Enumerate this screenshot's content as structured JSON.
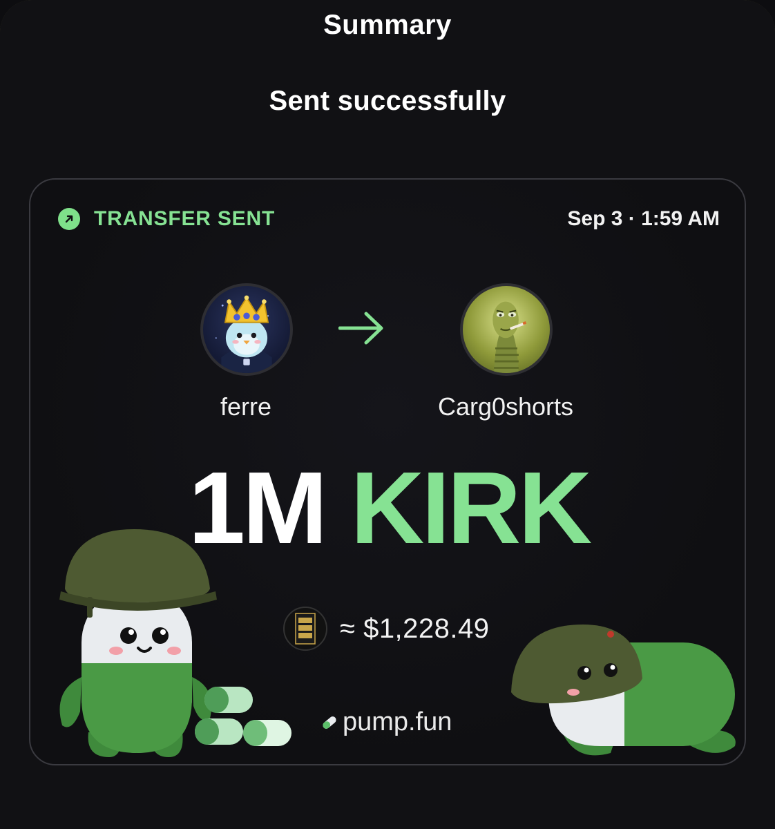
{
  "header": {
    "title": "Summary"
  },
  "status": {
    "subtitle": "Sent successfully"
  },
  "card": {
    "badge_label": "TRANSFER SENT",
    "timestamp": "Sep 3 · 1:59 AM",
    "sender": {
      "name": "ferre",
      "avatar_icon": "crowned-penguin-avatar"
    },
    "recipient": {
      "name": "Carg0shorts",
      "avatar_icon": "smoking-caterpillar-avatar"
    },
    "amount": {
      "value": "1M",
      "ticker": "KIRK"
    },
    "usd_equivalent": "≈ $1,228.49",
    "token_icon": "fight-fight-fight-token-icon",
    "token_icon_text": "FIGHT FIGHT FIGHT",
    "brand": "pump.fun",
    "colors": {
      "accent_green": "#86e293",
      "background": "#111114",
      "card_border": "#3a3a40"
    }
  }
}
